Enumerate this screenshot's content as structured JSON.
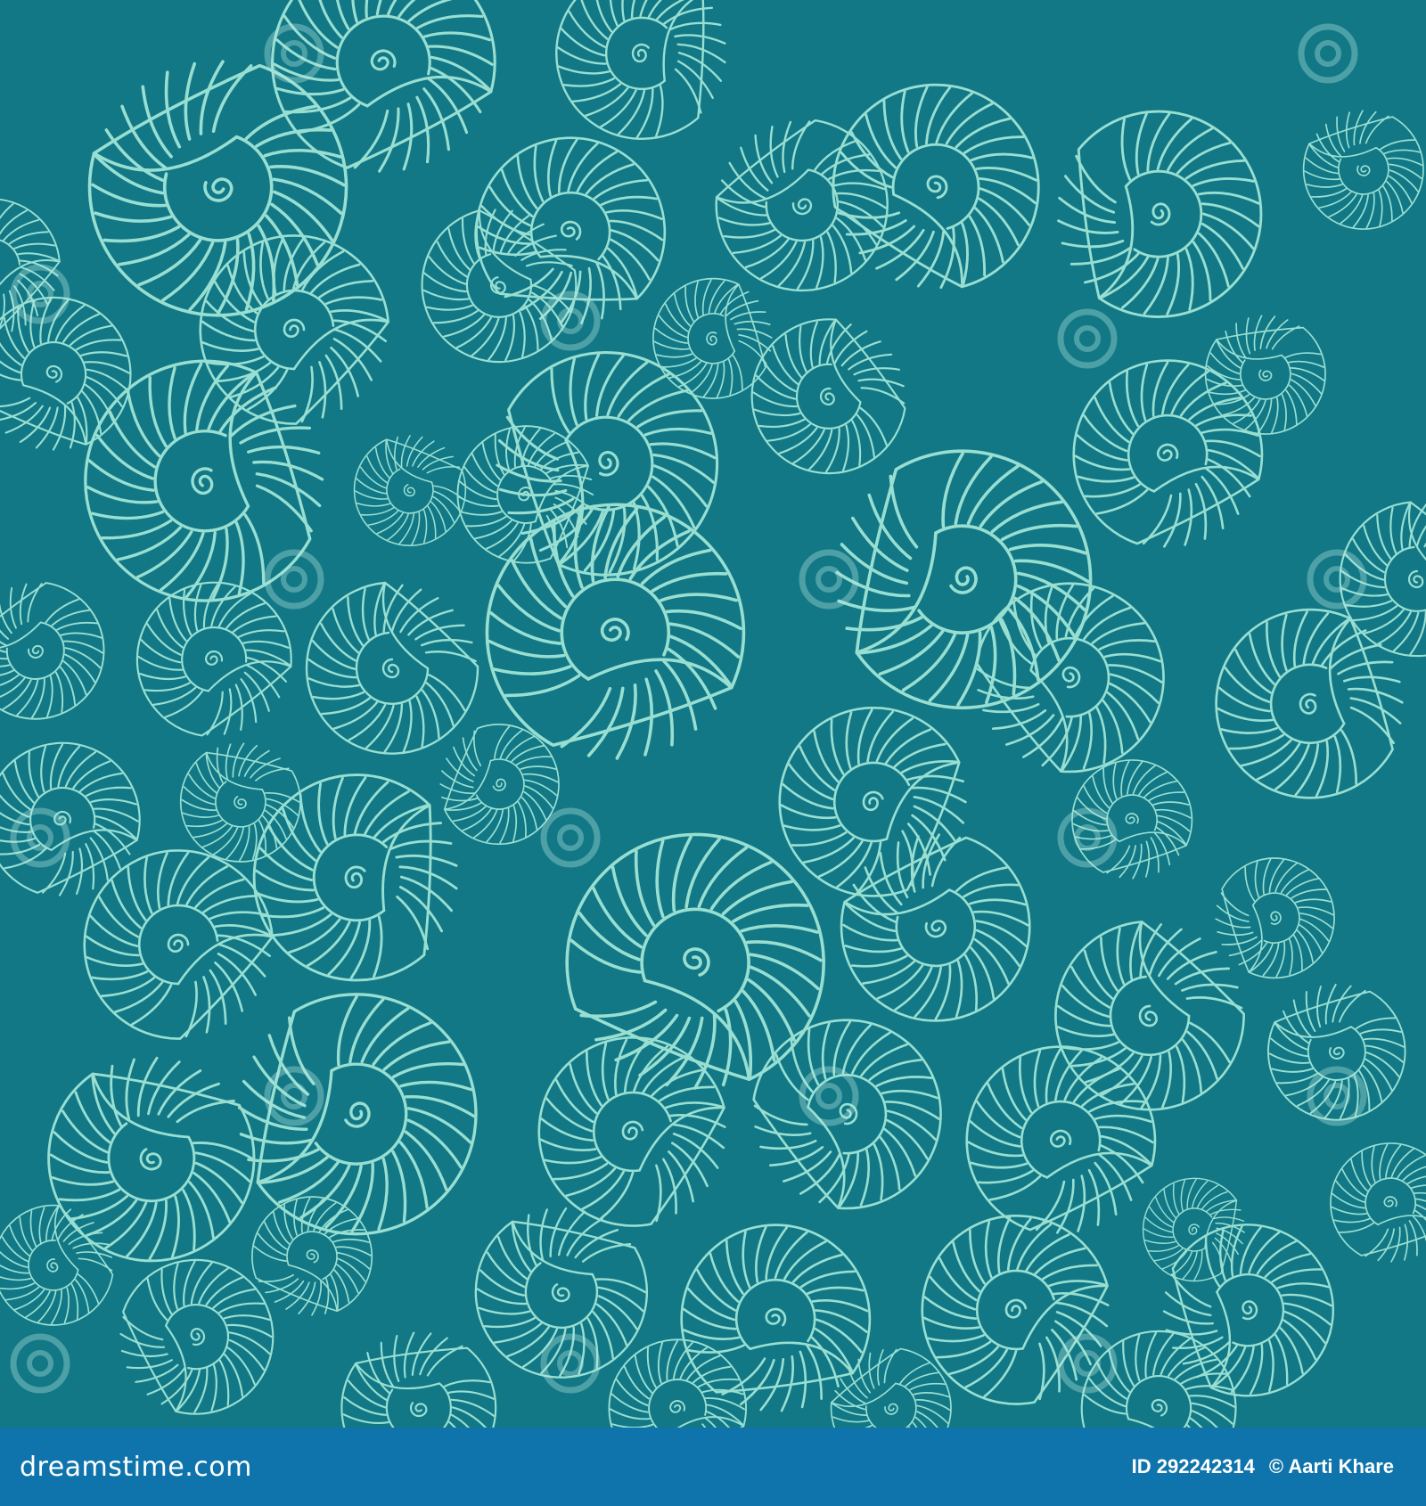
{
  "pattern": {
    "background_color": "#127886",
    "line_color": "#98dfd2",
    "motif": "spiral-seashell-icon"
  },
  "footer": {
    "background_color": "#0f74ab",
    "brand_text": "dreamstime.com",
    "id_label": "ID",
    "id_value": "292242314",
    "copyright_symbol": "©",
    "author": "Aarti Khare"
  },
  "watermark": {
    "text": "dreamstime"
  }
}
